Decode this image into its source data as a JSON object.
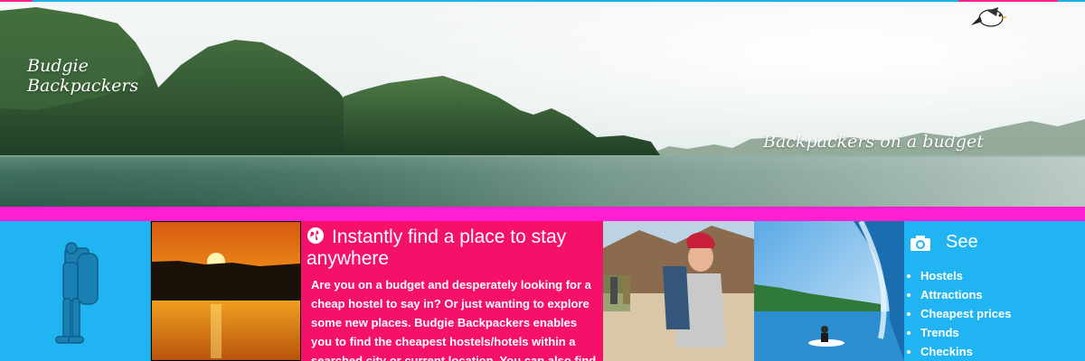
{
  "brand": {
    "line1": "Budgie",
    "line2": "Backpackers"
  },
  "hero": {
    "tagline": "Backpackers on a budget"
  },
  "find": {
    "title": "Instantly find a place to stay anywhere",
    "body": "Are you on a budget and desperately looking for a cheap hostel to say in? Or just wanting to explore some new places. Budgie Backpackers enables you to find the cheapest hostels/hotels within a searched city or current location. You can also find"
  },
  "see": {
    "title": "See",
    "items": [
      "Hostels",
      "Attractions",
      "Cheapest prices",
      "Trends",
      "Checkins"
    ]
  },
  "colors": {
    "accent_blue": "#20b5f2",
    "magenta": "#ff1fd2",
    "pink": "#f5106a"
  },
  "icons": [
    "budgie-logo-icon",
    "globe-icon",
    "camera-icon",
    "backpacker-icon"
  ]
}
